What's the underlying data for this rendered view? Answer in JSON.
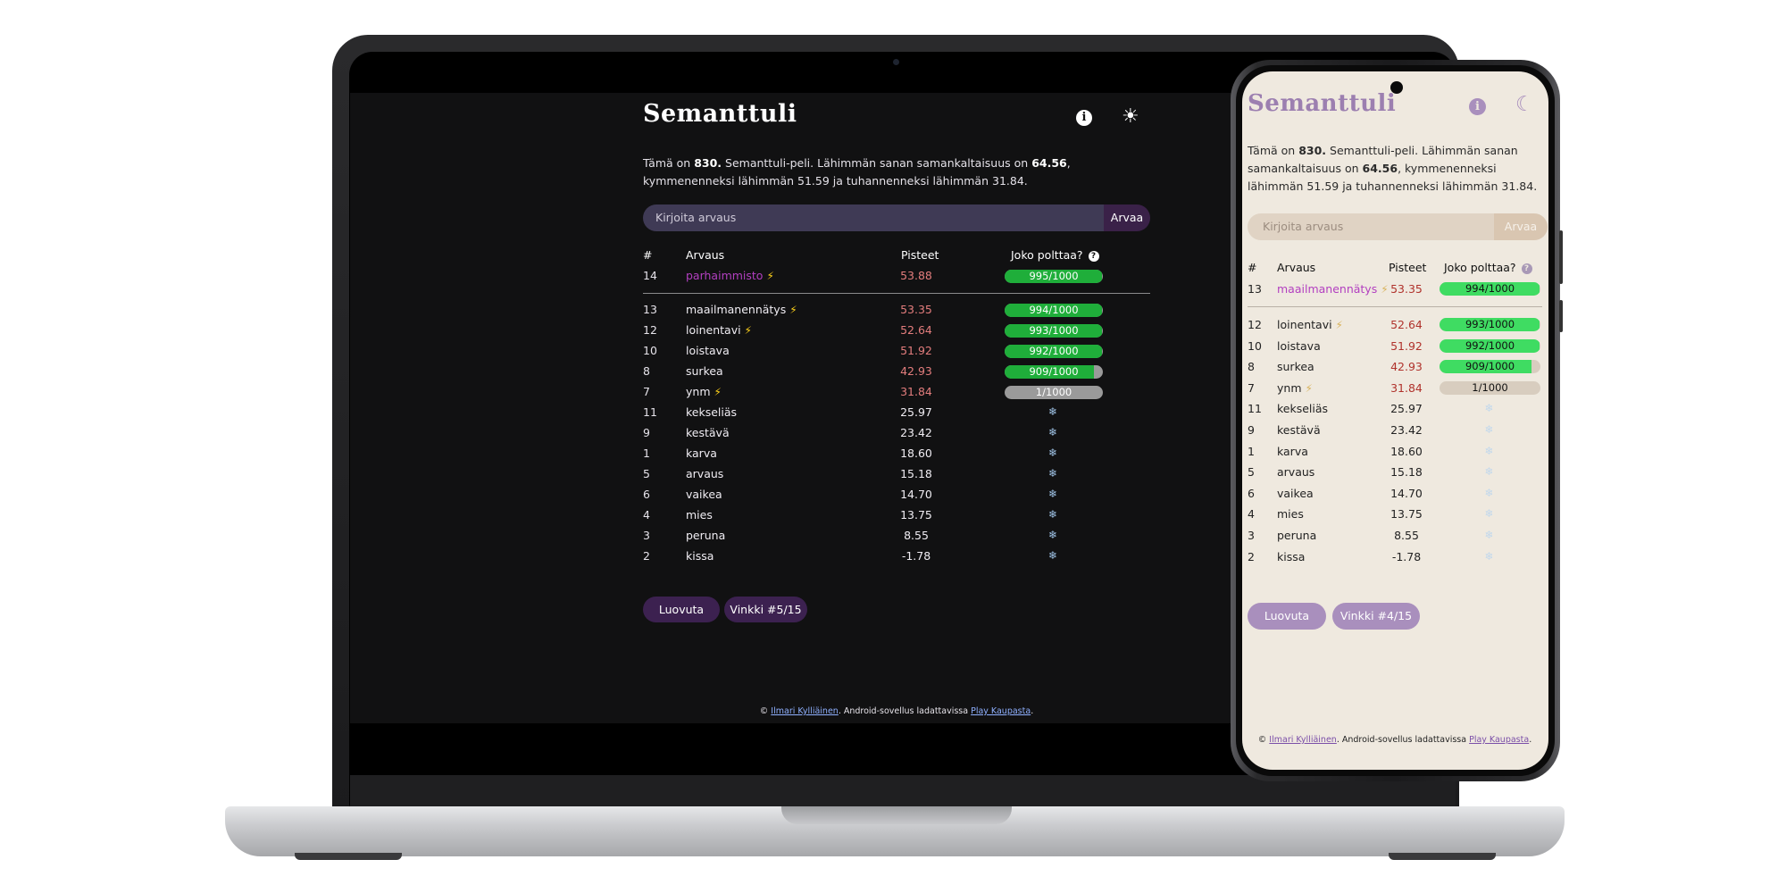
{
  "laptop": {
    "title": "Semanttuli",
    "intro": {
      "p1": "Tämä on ",
      "game_no": "830.",
      "p2": " Semanttuli-peli. Lähimmän sanan samankaltaisuus on ",
      "closest": "64.56",
      "p3": ", kymmenenneksi lähimmän 51.59 ja tuhannenneksi lähimmän 31.84."
    },
    "input_placeholder": "Kirjoita arvaus",
    "guess_button": "Arvaa",
    "headers": {
      "num": "#",
      "word": "Arvaus",
      "score": "Pisteet",
      "hot": "Joko polttaa?"
    },
    "latest": {
      "num": "14",
      "word": "parhaimmisto",
      "bolt": "⚡",
      "score": "53.88",
      "rank": "995/1000",
      "fill": 0.995
    },
    "rows": [
      {
        "num": "13",
        "word": "maailmanennätys",
        "bolt": "⚡",
        "score": "53.35",
        "rank": "994/1000",
        "fill": 0.994
      },
      {
        "num": "12",
        "word": "loinentavi",
        "bolt": "⚡",
        "score": "52.64",
        "rank": "993/1000",
        "fill": 0.993
      },
      {
        "num": "10",
        "word": "loistava",
        "bolt": "",
        "score": "51.92",
        "rank": "992/1000",
        "fill": 0.992
      },
      {
        "num": "8",
        "word": "surkea",
        "bolt": "",
        "score": "42.93",
        "rank": "909/1000",
        "fill": 0.909
      },
      {
        "num": "7",
        "word": "ynm",
        "bolt": "⚡",
        "score": "31.84",
        "rank": "1/1000",
        "fill": 0.001
      },
      {
        "num": "11",
        "word": "kekseliäs",
        "bolt": "",
        "score": "25.97",
        "rank": "",
        "fill": 0
      },
      {
        "num": "9",
        "word": "kestävä",
        "bolt": "",
        "score": "23.42",
        "rank": "",
        "fill": 0
      },
      {
        "num": "1",
        "word": "karva",
        "bolt": "",
        "score": "18.60",
        "rank": "",
        "fill": 0
      },
      {
        "num": "5",
        "word": "arvaus",
        "bolt": "",
        "score": "15.18",
        "rank": "",
        "fill": 0
      },
      {
        "num": "6",
        "word": "vaikea",
        "bolt": "",
        "score": "14.70",
        "rank": "",
        "fill": 0
      },
      {
        "num": "4",
        "word": "mies",
        "bolt": "",
        "score": "13.75",
        "rank": "",
        "fill": 0
      },
      {
        "num": "3",
        "word": "peruna",
        "bolt": "",
        "score": "8.55",
        "rank": "",
        "fill": 0
      },
      {
        "num": "2",
        "word": "kissa",
        "bolt": "",
        "score": "-1.78",
        "rank": "",
        "fill": 0
      }
    ],
    "snowflake": "❄",
    "give_up": "Luovuta",
    "hint": "Vinkki #5/15",
    "footer": {
      "copy": "© ",
      "author": "Ilmari Kylliäinen",
      "mid": ". Android-sovellus ladattavissa ",
      "store": "Play Kaupasta",
      "end": "."
    }
  },
  "phone": {
    "title": "Semanttuli",
    "intro": {
      "p1": "Tämä on ",
      "game_no": "830.",
      "p2": " Semanttuli-peli. Lähimmän sanan samankaltaisuus on ",
      "closest": "64.56",
      "p3": ", kymmenenneksi lähimmän 51.59 ja tuhannenneksi lähimmän 31.84."
    },
    "input_placeholder": "Kirjoita arvaus",
    "guess_button": "Arvaa",
    "headers": {
      "num": "#",
      "word": "Arvaus",
      "score": "Pisteet",
      "hot": "Joko polttaa?"
    },
    "latest": {
      "num": "13",
      "word": "maailmanennätys",
      "bolt": "⚡",
      "score": "53.35",
      "rank": "994/1000",
      "fill": 0.994
    },
    "rows": [
      {
        "num": "12",
        "word": "loinentavi",
        "bolt": "⚡",
        "score": "52.64",
        "rank": "993/1000",
        "fill": 0.993
      },
      {
        "num": "10",
        "word": "loistava",
        "bolt": "",
        "score": "51.92",
        "rank": "992/1000",
        "fill": 0.992
      },
      {
        "num": "8",
        "word": "surkea",
        "bolt": "",
        "score": "42.93",
        "rank": "909/1000",
        "fill": 0.909
      },
      {
        "num": "7",
        "word": "ynm",
        "bolt": "⚡",
        "score": "31.84",
        "rank": "1/1000",
        "fill": 0.001
      },
      {
        "num": "11",
        "word": "kekseliäs",
        "bolt": "",
        "score": "25.97",
        "rank": "",
        "fill": 0
      },
      {
        "num": "9",
        "word": "kestävä",
        "bolt": "",
        "score": "23.42",
        "rank": "",
        "fill": 0
      },
      {
        "num": "1",
        "word": "karva",
        "bolt": "",
        "score": "18.60",
        "rank": "",
        "fill": 0
      },
      {
        "num": "5",
        "word": "arvaus",
        "bolt": "",
        "score": "15.18",
        "rank": "",
        "fill": 0
      },
      {
        "num": "6",
        "word": "vaikea",
        "bolt": "",
        "score": "14.70",
        "rank": "",
        "fill": 0
      },
      {
        "num": "4",
        "word": "mies",
        "bolt": "",
        "score": "13.75",
        "rank": "",
        "fill": 0
      },
      {
        "num": "3",
        "word": "peruna",
        "bolt": "",
        "score": "8.55",
        "rank": "",
        "fill": 0
      },
      {
        "num": "2",
        "word": "kissa",
        "bolt": "",
        "score": "-1.78",
        "rank": "",
        "fill": 0
      }
    ],
    "snowflake": "❄",
    "give_up": "Luovuta",
    "hint": "Vinkki #4/15",
    "footer": {
      "copy": "© ",
      "author": "Ilmari Kylliäinen",
      "mid": ". Android-sovellus ladattavissa ",
      "store": "Play Kaupasta",
      "end": "."
    }
  },
  "colors": {
    "laptop_bg": "#111112",
    "laptop_latest_word": "#b23fc0",
    "laptop_score_hot": "#e37d7d",
    "laptop_bar_green": "#1fae3a",
    "laptop_bar_track": "#9a9a9a",
    "phone_bg": "#efe9df",
    "phone_accent": "#a98fbd",
    "phone_latest_word": "#b23fc0",
    "phone_score_hot": "#b0322c",
    "phone_bar_green": "#3fdc62",
    "phone_bar_track": "#d8cdbf"
  }
}
